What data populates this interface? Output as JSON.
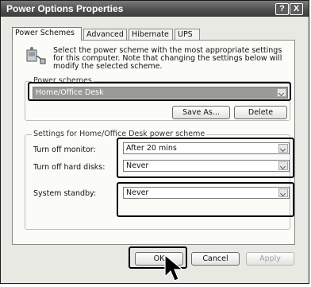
{
  "window": {
    "title": "Power Options Properties",
    "help_label": "?",
    "close_label": "X"
  },
  "tabs": [
    {
      "label": "Power Schemes",
      "active": true
    },
    {
      "label": "Advanced",
      "active": false
    },
    {
      "label": "Hibernate",
      "active": false
    },
    {
      "label": "UPS",
      "active": false
    }
  ],
  "description": "Select the power scheme with the most appropriate settings for this computer. Note that changing the settings below will modify the selected scheme.",
  "power_schemes": {
    "group_label": "Power schemes",
    "selected": "Home/Office Desk",
    "save_as_label": "Save As...",
    "delete_label": "Delete"
  },
  "settings": {
    "group_label": "Settings for Home/Office Desk power scheme",
    "rows": [
      {
        "label": "Turn off monitor:",
        "value": "After 20 mins"
      },
      {
        "label": "Turn off hard disks:",
        "value": "Never"
      },
      {
        "label": "System standby:",
        "value": "Never"
      }
    ]
  },
  "buttons": {
    "ok": "OK",
    "cancel": "Cancel",
    "apply": "Apply"
  },
  "icons": {
    "scheme_icon": "power-scheme-icon",
    "cursor": "mouse-pointer-icon"
  },
  "colors": {
    "titlebar": "#4d4d4d",
    "highlight": "#9a9a98",
    "callout": "#000000"
  }
}
